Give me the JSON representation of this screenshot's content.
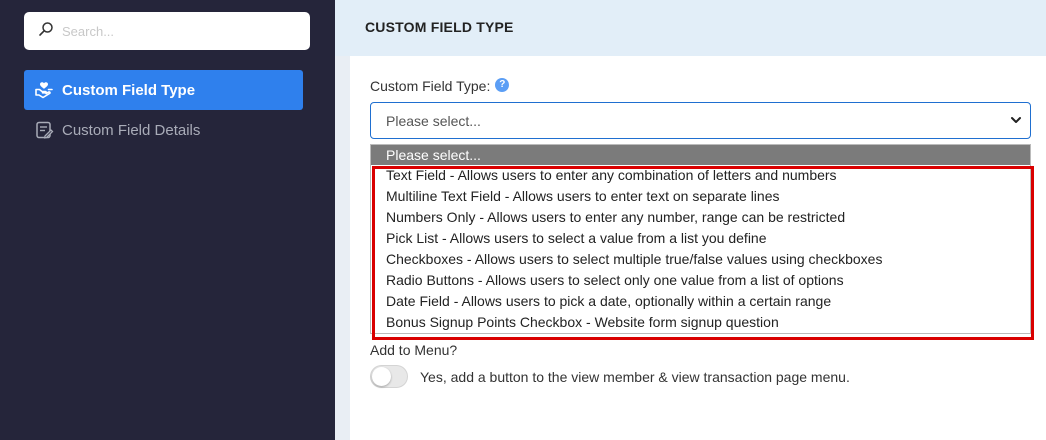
{
  "sidebar": {
    "search": {
      "placeholder": "Search..."
    },
    "items": [
      {
        "label": "Custom Field Type",
        "icon": "hand-heart-icon",
        "active": true
      },
      {
        "label": "Custom Field Details",
        "icon": "form-list-icon",
        "active": false
      }
    ]
  },
  "header": {
    "title": "CUSTOM FIELD TYPE"
  },
  "form": {
    "field_label": "Custom Field Type:",
    "help_glyph": "?",
    "select_value": "Please select...",
    "options": [
      "Please select...",
      "Text Field - Allows users to enter any combination of letters and numbers",
      "Multiline Text Field - Allows users to enter text on separate lines",
      "Numbers Only - Allows users to enter any number, range can be restricted",
      "Pick List - Allows users to select a value from a list you define",
      "Checkboxes - Allows users to select multiple true/false values using checkboxes",
      "Radio Buttons - Allows users to select only one value from a list of options",
      "Date Field - Allows users to pick a date, optionally within a certain range",
      "Bonus Signup Points Checkbox - Website form signup question"
    ],
    "menu_label": "Add to Menu?",
    "toggle_label": "Yes, add a button to the view member & view transaction page menu.",
    "toggle_on": false
  },
  "colors": {
    "sidebar_bg": "#25253a",
    "accent": "#2f80ed",
    "header_bg": "#e2eef8",
    "highlight": "#d90000",
    "selected_option_bg": "#7b7b7b"
  }
}
